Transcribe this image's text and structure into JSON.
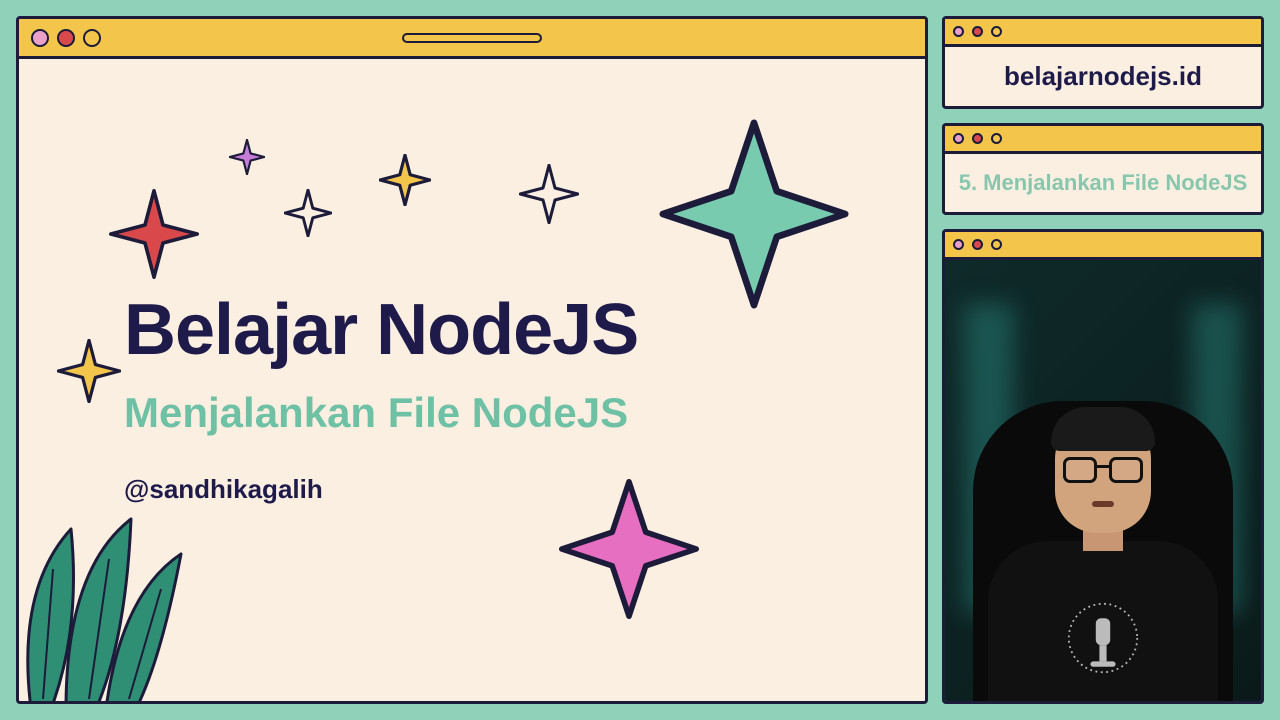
{
  "main": {
    "title": "Belajar NodeJS",
    "subtitle": "Menjalankan File NodeJS",
    "handle": "@sandhikagalih"
  },
  "sidebar": {
    "site": "belajarnodejs.id",
    "lesson": "5. Menjalankan File NodeJS"
  },
  "colors": {
    "bg": "#8FD1B9",
    "panel": "#FBEFE1",
    "bar": "#F3C54B",
    "ink": "#1E1B4B",
    "mint": "#6FC1A5",
    "red": "#D9484B",
    "pink": "#E66FC1",
    "violet": "#C77DD8"
  }
}
